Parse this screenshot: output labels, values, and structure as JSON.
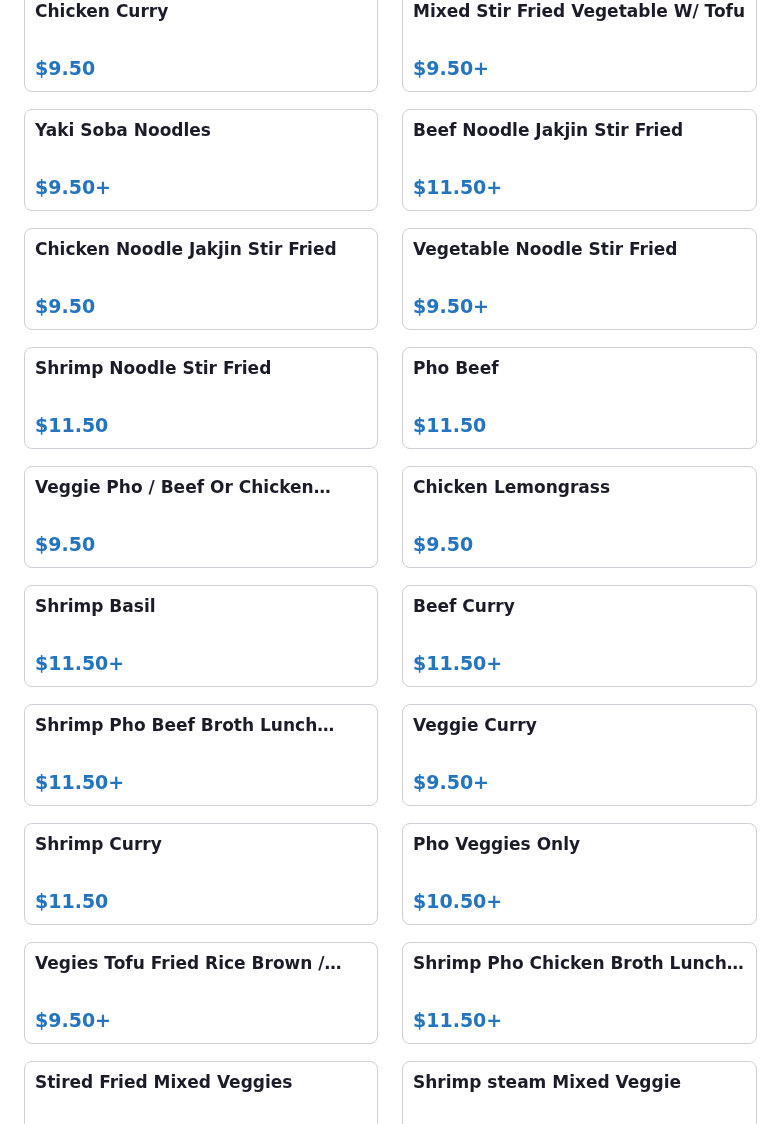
{
  "menu_items": [
    {
      "name": "Chicken Curry",
      "price": "$9.50"
    },
    {
      "name": "Mixed Stir Fried Vegetable W/ Tofu",
      "price": "$9.50+"
    },
    {
      "name": "Yaki Soba Noodles",
      "price": "$9.50+"
    },
    {
      "name": "Beef Noodle Jakjin Stir Fried",
      "price": "$11.50+"
    },
    {
      "name": "Chicken Noodle Jakjin Stir Fried",
      "price": "$9.50"
    },
    {
      "name": "Vegetable Noodle Stir Fried",
      "price": "$9.50+"
    },
    {
      "name": "Shrimp Noodle Stir Fried",
      "price": "$11.50"
    },
    {
      "name": "Pho Beef",
      "price": "$11.50"
    },
    {
      "name": "Veggie Pho / Beef Or Chicken…",
      "price": "$9.50"
    },
    {
      "name": "Chicken Lemongrass",
      "price": "$9.50"
    },
    {
      "name": "Shrimp Basil",
      "price": "$11.50+"
    },
    {
      "name": "Beef Curry",
      "price": "$11.50+"
    },
    {
      "name": "Shrimp Pho Beef Broth Lunch…",
      "price": "$11.50+"
    },
    {
      "name": "Veggie Curry",
      "price": "$9.50+"
    },
    {
      "name": "Shrimp Curry",
      "price": "$11.50"
    },
    {
      "name": "Pho Veggies Only",
      "price": "$10.50+"
    },
    {
      "name": "Vegies Tofu Fried Rice Brown /…",
      "price": "$9.50+"
    },
    {
      "name": "Shrimp Pho Chicken Broth Lunch…",
      "price": "$11.50+"
    },
    {
      "name": "Stired Fried Mixed Veggies"
    },
    {
      "name": "Shrimp steam Mixed Veggie"
    }
  ]
}
